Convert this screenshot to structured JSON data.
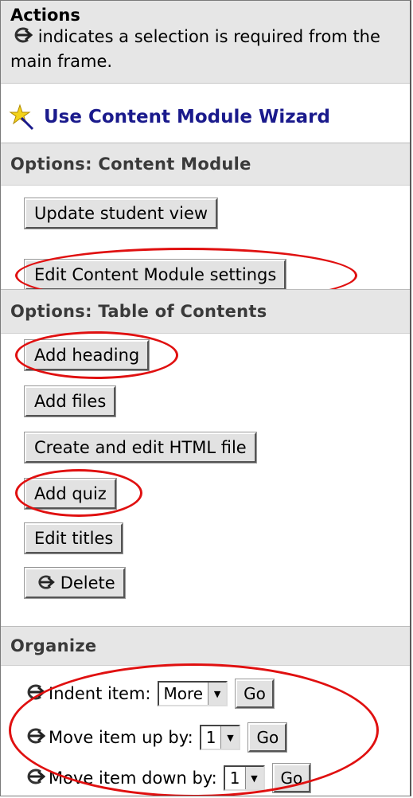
{
  "actions": {
    "title": "Actions",
    "note": "indicates a selection is required from the main frame."
  },
  "wizard": {
    "label": "Use Content Module Wizard"
  },
  "content_module": {
    "heading": "Options: Content Module",
    "buttons": [
      "Update student view",
      "Edit Content Module settings"
    ]
  },
  "toc": {
    "heading": "Options: Table of Contents",
    "buttons": [
      "Add heading",
      "Add files",
      "Create and edit HTML file",
      "Add quiz",
      "Edit titles",
      "Delete"
    ]
  },
  "organize": {
    "heading": "Organize",
    "rows": [
      {
        "label": "Indent item:",
        "value": "More",
        "go": "Go"
      },
      {
        "label": "Move item up by:",
        "value": "1",
        "go": "Go"
      },
      {
        "label": "Move item down by:",
        "value": "1",
        "go": "Go"
      }
    ]
  },
  "colors": {
    "ring": "#e01010",
    "link": "#1a1a8c",
    "header_bg": "#e6e6e6"
  }
}
